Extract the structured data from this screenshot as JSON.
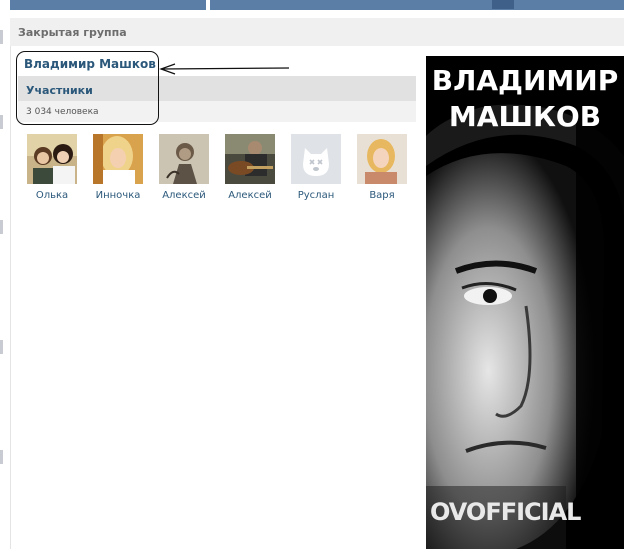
{
  "header": {
    "title": "Закрытая группа"
  },
  "group": {
    "name": "Владимир Машков",
    "members_label": "Участники",
    "members_count": "3 034 человека"
  },
  "members": [
    {
      "name": "Олька",
      "avatar": "photo-two-girls"
    },
    {
      "name": "Инночка",
      "avatar": "photo-blonde-girl"
    },
    {
      "name": "Алексей",
      "avatar": "photo-drawing"
    },
    {
      "name": "Алексей",
      "avatar": "photo-guitar-player"
    },
    {
      "name": "Руслан",
      "avatar": "default-dog-avatar"
    },
    {
      "name": "Варя",
      "avatar": "photo-blonde-woman"
    }
  ],
  "poster": {
    "title_line1": "ВЛАДИМИР",
    "title_line2": "МАШКОВ",
    "brand": "OVOFFICIAL"
  },
  "colors": {
    "link": "#2b587a",
    "nav": "#5b7ea6",
    "header_bg": "#f0f0f0",
    "members_bar": "#e1e1e1"
  }
}
